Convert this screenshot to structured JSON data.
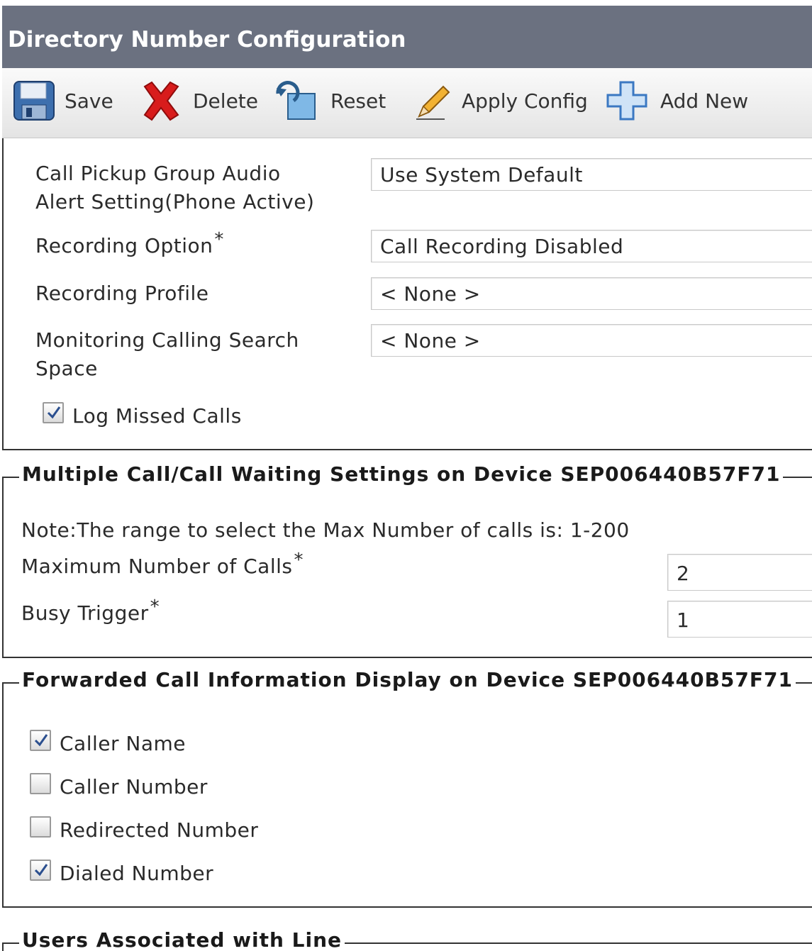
{
  "header": {
    "title": "Directory Number Configuration"
  },
  "toolbar": {
    "save": "Save",
    "delete": "Delete",
    "reset": "Reset",
    "apply_config": "Apply Config",
    "add_new": "Add New"
  },
  "line_settings": {
    "call_pickup_label_1": "Call Pickup Group Audio",
    "call_pickup_label_2": "Alert Setting(Phone Active)",
    "call_pickup_value": "Use System Default",
    "recording_option_label": "Recording Option",
    "recording_option_value": "Call Recording Disabled",
    "recording_profile_label": "Recording Profile",
    "recording_profile_value": "< None >",
    "monitoring_css_label_1": "Monitoring Calling Search",
    "monitoring_css_label_2": "Space",
    "monitoring_css_value": "< None >",
    "log_missed_calls": {
      "label": "Log Missed Calls",
      "checked": true
    }
  },
  "multiple_call": {
    "legend": "Multiple Call/Call Waiting Settings on Device SEP006440B57F71",
    "note": "Note:The range to select the Max Number of calls is: 1-200",
    "max_calls_label": "Maximum Number of Calls",
    "max_calls_value": "2",
    "busy_trigger_label": "Busy Trigger",
    "busy_trigger_value": "1"
  },
  "forwarded_display": {
    "legend": "Forwarded Call Information Display on Device SEP006440B57F71",
    "items": [
      {
        "label": "Caller Name",
        "checked": true
      },
      {
        "label": "Caller Number",
        "checked": false
      },
      {
        "label": "Redirected Number",
        "checked": false
      },
      {
        "label": "Dialed Number",
        "checked": true
      }
    ]
  },
  "users_section": {
    "legend": "Users Associated with Line"
  },
  "required_marker": "*",
  "icons": {
    "save": "floppy-disk-icon",
    "delete": "red-x-icon",
    "reset": "reset-icon",
    "apply_config": "pencil-icon",
    "add_new": "blue-plus-icon"
  }
}
